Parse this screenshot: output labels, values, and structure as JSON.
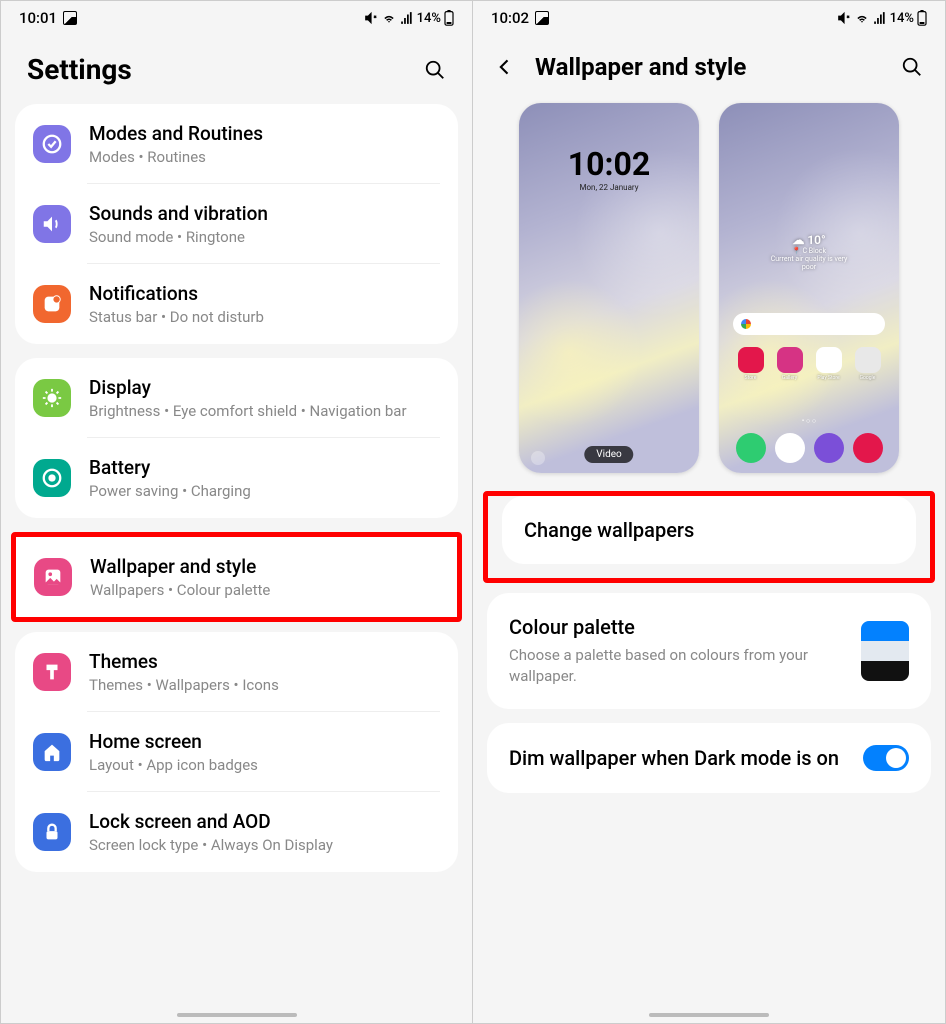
{
  "left": {
    "status": {
      "time": "10:01",
      "battery": "14%"
    },
    "title": "Settings",
    "groups": [
      [
        {
          "icon": "modes",
          "color": "#8075e6",
          "title": "Modes and Routines",
          "sub": "Modes  •  Routines"
        },
        {
          "icon": "sound",
          "color": "#8075e6",
          "title": "Sounds and vibration",
          "sub": "Sound mode  •  Ringtone"
        },
        {
          "icon": "notif",
          "color": "#f1672f",
          "title": "Notifications",
          "sub": "Status bar  •  Do not disturb"
        }
      ],
      [
        {
          "icon": "display",
          "color": "#7ac943",
          "title": "Display",
          "sub": "Brightness  •  Eye comfort shield  •  Navigation bar"
        },
        {
          "icon": "battery",
          "color": "#00a98f",
          "title": "Battery",
          "sub": "Power saving  •  Charging"
        }
      ],
      [
        {
          "icon": "wallpaper",
          "color": "#e84985",
          "title": "Wallpaper and style",
          "sub": "Wallpapers  •  Colour palette",
          "highlight": true
        },
        {
          "icon": "themes",
          "color": "#e84985",
          "title": "Themes",
          "sub": "Themes  •  Wallpapers  •  Icons"
        },
        {
          "icon": "home",
          "color": "#3b6fe0",
          "title": "Home screen",
          "sub": "Layout  •  App icon badges"
        },
        {
          "icon": "lock",
          "color": "#3b6fe0",
          "title": "Lock screen and AOD",
          "sub": "Screen lock type  •  Always On Display"
        }
      ]
    ]
  },
  "right": {
    "status": {
      "time": "10:02",
      "battery": "14%"
    },
    "title": "Wallpaper and style",
    "lock": {
      "time": "10:02",
      "date": "Mon, 22 January",
      "badge": "Video"
    },
    "home": {
      "weather": {
        "temp": "10°",
        "loc": "C Block",
        "air": "Current air quality is very poor"
      },
      "apps": [
        {
          "label": "Store",
          "bg": "#e3174b"
        },
        {
          "label": "Gallery",
          "bg": "#d63384"
        },
        {
          "label": "Play Store",
          "bg": "#ffffff"
        },
        {
          "label": "Google",
          "bg": "#e8e8e8"
        }
      ],
      "dock": [
        {
          "bg": "#2ecc71"
        },
        {
          "bg": "#ffffff"
        },
        {
          "bg": "#7b4fd8"
        },
        {
          "bg": "#e3174b"
        }
      ]
    },
    "change": "Change wallpapers",
    "palette": {
      "title": "Colour palette",
      "sub": "Choose a palette based on colours from your wallpaper.",
      "colors": [
        "#0381fe",
        "#e3e9f0",
        "#111"
      ]
    },
    "dim": {
      "title": "Dim wallpaper when Dark mode is on",
      "on": true
    }
  }
}
